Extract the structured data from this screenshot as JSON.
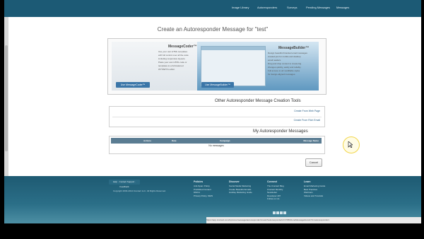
{
  "nav": {
    "items": [
      "Image Library",
      "Autoresponders",
      "Surveys",
      "Pending Messages",
      "Messages"
    ]
  },
  "page": {
    "title": "Create an Autoresponder Message for \"test\""
  },
  "builders": {
    "message_builder": {
      "title": "MessageBuilder™",
      "lines": [
        "Design beautiful branded email messages",
        "created just for mobile and desktop",
        "email readers.",
        "Drag and drop content to create big",
        "changes quickly, easily and reliably.",
        "Full access to all modifiable styles",
        "for design-aligned messages."
      ],
      "button": "Use MessageBuilder™"
    },
    "message_coder": {
      "title": "MessageCoder™",
      "lines": [
        "Use your own HTML templates",
        "with full control over all the code",
        "including responsive layouts.",
        "Paste your own HTML code or",
        "templates to a full-featured",
        "WYSIWYG editor."
      ],
      "button": "Use MessageCoder™"
    }
  },
  "other_tools": {
    "title": "Other Autoresponder Message Creation Tools",
    "links": [
      "Create From Web Page",
      "Create From Rich Email"
    ]
  },
  "my_messages": {
    "title": "My Autoresponder Messages",
    "columns": [
      "Message Name",
      "Campaign",
      "Date",
      "Actions"
    ],
    "empty_text": "No messages"
  },
  "cancel_label": "Cancel",
  "footer": {
    "columns": [
      {
        "heading": "Learn",
        "links": [
          "Email Marketing Guide",
          "Best Practices",
          "Webinars",
          "Videos and Tutorials"
        ]
      },
      {
        "heading": "Connect",
        "links": [
          "The iContact Blog",
          "iContact Monthly",
          "Newsletter",
          "Developer API",
          "Follow on Us"
        ]
      },
      {
        "heading": "Discover",
        "links": [
          "Social Media Marketing",
          "Create Beautiful Emails",
          "Holiday Marketing Guide"
        ]
      },
      {
        "heading": "Policies",
        "links": [
          "Anti-Spam Policy",
          "Prohibited Content",
          "DMCA",
          "Privacy Policy, NEW"
        ]
      }
    ],
    "help_label": "Help",
    "support_label": "Contact Support",
    "feedback_label": "Feedback",
    "copyright": "Copyright 2003-2014 iContact LLC. All Rights Reserved."
  },
  "statusbar_text": "https://app.icontact.com/icp/core/message/autoresponder/create?autoresponderId=3795#cloneMessage&returnTo=autoresponders"
}
